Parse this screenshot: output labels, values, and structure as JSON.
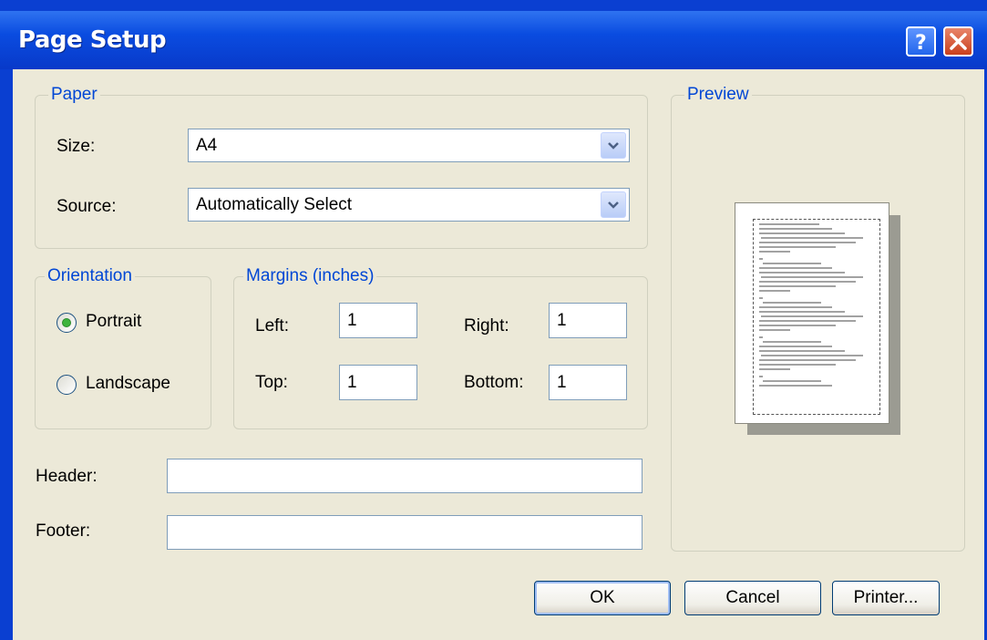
{
  "window": {
    "title": "Page Setup"
  },
  "paper": {
    "legend": "Paper",
    "size_label": "Size:",
    "size_value": "A4",
    "source_label": "Source:",
    "source_value": "Automatically Select"
  },
  "orientation": {
    "legend": "Orientation",
    "options": [
      {
        "label": "Portrait",
        "selected": true
      },
      {
        "label": "Landscape",
        "selected": false
      }
    ]
  },
  "margins": {
    "legend": "Margins (inches)",
    "left_label": "Left:",
    "left_value": "1",
    "right_label": "Right:",
    "right_value": "1",
    "top_label": "Top:",
    "top_value": "1",
    "bottom_label": "Bottom:",
    "bottom_value": "1"
  },
  "header_footer": {
    "header_label": "Header:",
    "header_value": "",
    "footer_label": "Footer:",
    "footer_value": ""
  },
  "preview": {
    "legend": "Preview"
  },
  "buttons": {
    "ok": "OK",
    "cancel": "Cancel",
    "printer": "Printer..."
  },
  "icons": {
    "help": "help-icon",
    "close": "close-icon",
    "dropdown": "chevron-down-icon"
  },
  "colors": {
    "titlebar": "#0a4ce0",
    "legend_text": "#0046d5",
    "dialog_bg": "#ece9d8",
    "close_button": "#c9401d",
    "radio_selected": "#3eb43e"
  }
}
